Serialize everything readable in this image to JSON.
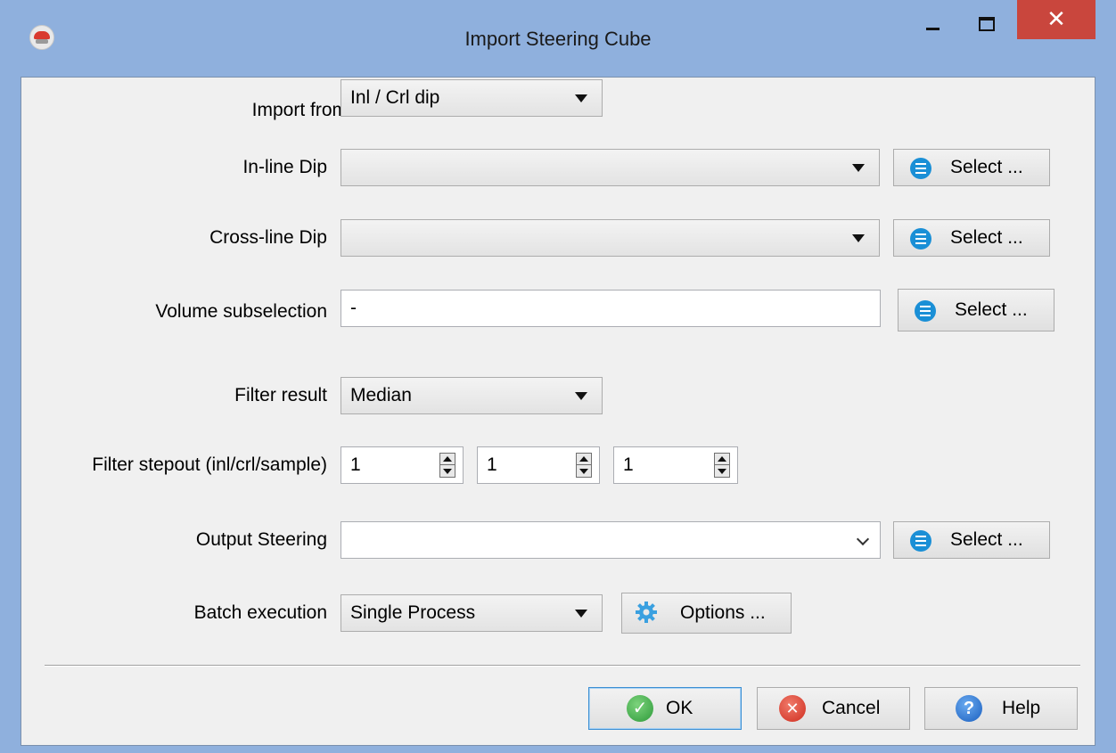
{
  "window": {
    "title": "Import Steering Cube",
    "app_icon": "opendtect-icon",
    "controls": {
      "minimize": "minimize-icon",
      "maximize": "maximize-icon",
      "close": "✕"
    }
  },
  "form": {
    "import_from": {
      "label": "Import from",
      "value": "Inl / Crl dip"
    },
    "inline_dip": {
      "label": "In-line Dip",
      "value": "",
      "select_label": "Select ..."
    },
    "crossline_dip": {
      "label": "Cross-line Dip",
      "value": "",
      "select_label": "Select ..."
    },
    "volume_subselection": {
      "label": "Volume subselection",
      "value": "-",
      "select_label": "Select ..."
    },
    "filter_result": {
      "label": "Filter result",
      "value": "Median"
    },
    "filter_stepout": {
      "label": "Filter stepout (inl/crl/sample)",
      "values": [
        "1",
        "1",
        "1"
      ]
    },
    "output_steering": {
      "label": "Output Steering",
      "value": "",
      "select_label": "Select ..."
    },
    "batch_execution": {
      "label": "Batch execution",
      "value": "Single Process",
      "options_label": "Options ..."
    }
  },
  "footer": {
    "ok": "OK",
    "cancel": "Cancel",
    "help": "Help"
  },
  "colors": {
    "titlebar": "#8fb0dd",
    "close_button": "#c9463d",
    "dialog_bg": "#f0f0f0",
    "select_icon": "#1a8fd6"
  }
}
